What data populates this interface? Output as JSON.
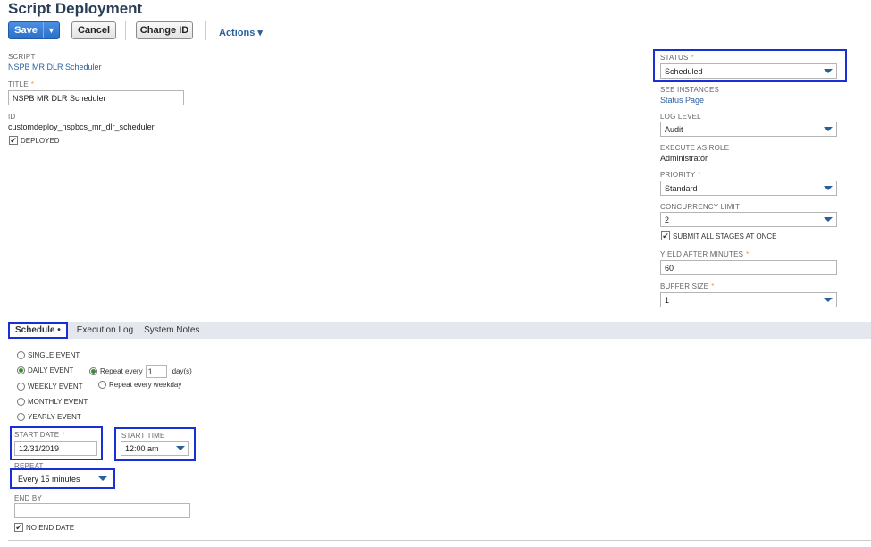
{
  "header": {
    "title": "Script Deployment",
    "save_label": "Save",
    "save_arrow": "▼",
    "cancel_label": "Cancel",
    "change_id_label": "Change ID",
    "actions_label": "Actions ▾"
  },
  "left": {
    "script_label": "SCRIPT",
    "script_value": "NSPB MR DLR Scheduler",
    "title_label": "TITLE",
    "title_value": "NSPB MR DLR Scheduler",
    "id_label": "ID",
    "id_value": "customdeploy_nspbcs_mr_dlr_scheduler",
    "deployed_label": "DEPLOYED",
    "deployed_checked": true
  },
  "right": {
    "status_label": "STATUS",
    "status_value": "Scheduled",
    "see_instances_label": "SEE INSTANCES",
    "status_page_link": "Status Page",
    "log_level_label": "LOG LEVEL",
    "log_level_value": "Audit",
    "execute_as_role_label": "EXECUTE AS ROLE",
    "execute_as_role_value": "Administrator",
    "priority_label": "PRIORITY",
    "priority_value": "Standard",
    "concurrency_label": "CONCURRENCY LIMIT",
    "concurrency_value": "2",
    "submit_all_label": "SUBMIT ALL STAGES AT ONCE",
    "yield_label": "YIELD AFTER MINUTES",
    "yield_value": "60",
    "buffer_label": "BUFFER SIZE",
    "buffer_value": "1"
  },
  "tabs": [
    {
      "label": "Schedule •"
    },
    {
      "label": "Execution Log"
    },
    {
      "label": "System Notes"
    }
  ],
  "schedule": {
    "single_event": "SINGLE EVENT",
    "daily_event": "DAILY EVENT",
    "weekly_event": "WEEKLY EVENT",
    "monthly_event": "MONTHLY EVENT",
    "yearly_event": "YEARLY EVENT",
    "repeat_every_label": "Repeat every",
    "repeat_every_value": "1",
    "days_label": "day(s)",
    "repeat_weekday_label": "Repeat every weekday",
    "start_date_label": "START DATE",
    "start_date_value": "12/31/2019",
    "start_time_label": "START TIME",
    "start_time_value": "12:00 am",
    "repeat_label": "REPEAT",
    "repeat_value": "Every 15 minutes",
    "end_by_label": "END BY",
    "end_by_value": "",
    "no_end_date_label": "NO END DATE"
  },
  "colors": {
    "accent": "#2a5f9e",
    "highlight": "#1a2fd6",
    "required": "#e8a317"
  }
}
